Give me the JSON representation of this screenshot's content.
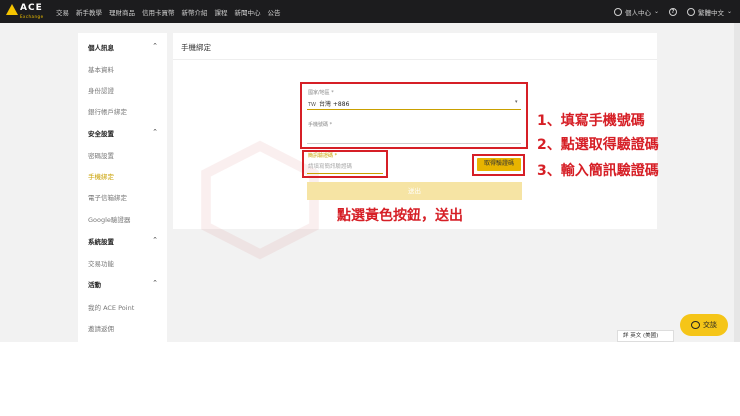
{
  "nav": {
    "brand": "ACE",
    "brand_sub": "Exchange",
    "links": [
      "交易",
      "新手教學",
      "理財商品",
      "信用卡買幣",
      "新幣介紹",
      "課程",
      "新聞中心",
      "公告"
    ],
    "account_label": "個人中心",
    "help_label": "?",
    "language_label": "繁體中文"
  },
  "sidebar": {
    "sections": [
      {
        "title": "個人訊息",
        "items": [
          "基本資料",
          "身份認證",
          "銀行帳戶綁定"
        ]
      },
      {
        "title": "安全設置",
        "items": [
          "密碼設置",
          "手機綁定",
          "電子信箱綁定",
          "Google驗證器"
        ]
      },
      {
        "title": "系統設置",
        "items": [
          "交易功能"
        ]
      },
      {
        "title": "活動",
        "items": [
          "我的 ACE Point",
          "邀請返佣"
        ]
      }
    ],
    "active_item": "手機綁定"
  },
  "form": {
    "title": "手機綁定",
    "country_label": "國家/地區 *",
    "country_flag": "TW",
    "country_value": "台灣 +886",
    "phone_label": "手機號碼 *",
    "code_label": "簡訊驗證碼 *",
    "code_placeholder": "請填寫簡訊驗證碼",
    "get_code_label": "取得驗證碼",
    "submit_label": "送出"
  },
  "annotations": {
    "step1": "1、填寫手機號碼",
    "step2": "2、點選取得驗證碼",
    "step3": "3、輸入簡訊驗證碼",
    "bottom": "點選黃色按鈕，送出"
  },
  "chat": {
    "label": "交談"
  },
  "lang_popup": {
    "text": "詳 英文 (美國)"
  },
  "colors": {
    "accent": "#e8b400",
    "annotation_red": "#d61f26",
    "nav_bg": "#1c1c1e"
  }
}
